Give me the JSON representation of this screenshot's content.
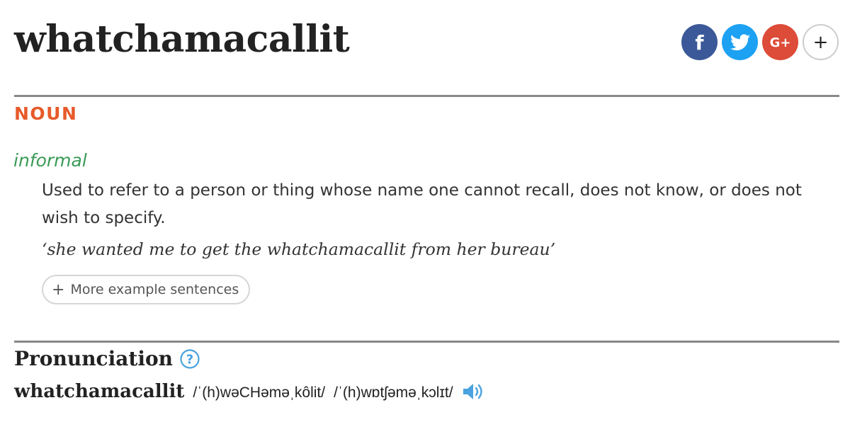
{
  "entry": {
    "headword": "whatchamacallit"
  },
  "share": {
    "buttons": [
      {
        "name": "facebook",
        "label": "f",
        "icon": "facebook-icon",
        "color": "#3b5998"
      },
      {
        "name": "twitter",
        "label": "",
        "icon": "twitter-bird-icon",
        "color": "#1da1f2"
      },
      {
        "name": "google-plus",
        "label": "G+",
        "icon": "google-plus-icon",
        "color": "#dd4b39"
      },
      {
        "name": "more",
        "label": "+",
        "icon": "plus-icon",
        "color": "#ffffff"
      }
    ]
  },
  "sense": {
    "part_of_speech": "NOUN",
    "register": "informal",
    "definition": "Used to refer to a person or thing whose name one cannot recall, does not know, or does not wish to specify.",
    "example": "‘she wanted me to get the whatchamacallit from her bureau’",
    "more_examples_label": "More example sentences",
    "more_examples_icon": "+"
  },
  "pronunciation": {
    "title": "Pronunciation",
    "help_icon": "question-circle-icon",
    "word": "whatchamacallit",
    "ipa_us": "/ˈ(h)wəCHəməˌkôlit/",
    "ipa_uk": "/ˈ(h)wɒtʃəməˌkɔlɪt/",
    "audio_icon": "speaker-icon"
  },
  "colors": {
    "part_of_speech": "#e75a2a",
    "register": "#3b9a57",
    "accent_blue": "#4aa3df",
    "rule": "#888888"
  }
}
